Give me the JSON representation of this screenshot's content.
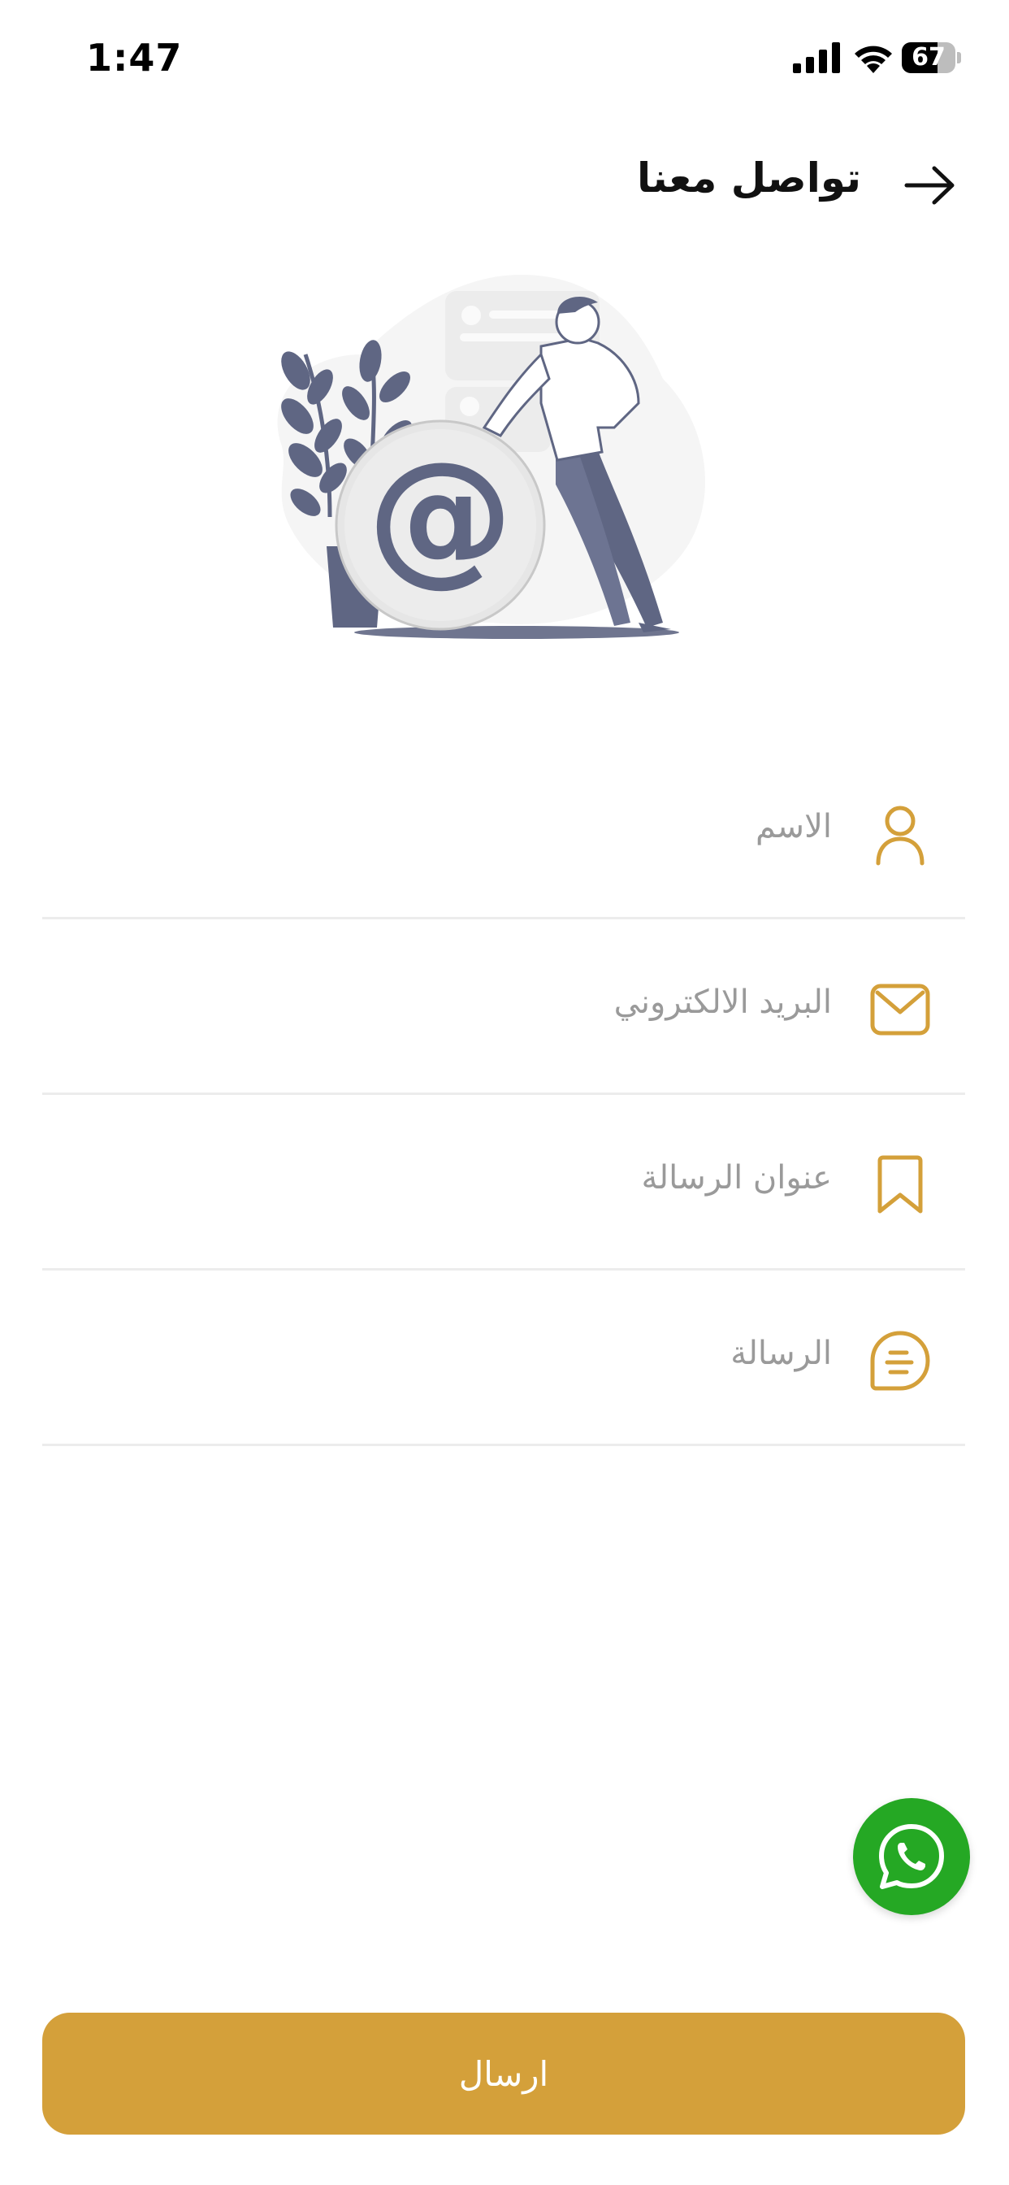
{
  "status_bar": {
    "time": "1:47",
    "battery": "67",
    "battery_level": 0.67
  },
  "header": {
    "title": "تواصل معنا",
    "back_icon": "arrow-right-icon"
  },
  "form": {
    "fields": [
      {
        "label": "الاسم",
        "icon": "user-icon"
      },
      {
        "label": "البريد الالكتروني",
        "icon": "mail-icon"
      },
      {
        "label": "عنوان الرسالة",
        "icon": "bookmark-icon"
      },
      {
        "label": "الرسالة",
        "icon": "message-icon"
      }
    ],
    "submit_label": "ارسال"
  },
  "whatsapp": {
    "icon": "whatsapp-icon"
  },
  "colors": {
    "accent": "#d4a03a",
    "whatsapp": "#25a824",
    "illustration": "#5f6683"
  }
}
